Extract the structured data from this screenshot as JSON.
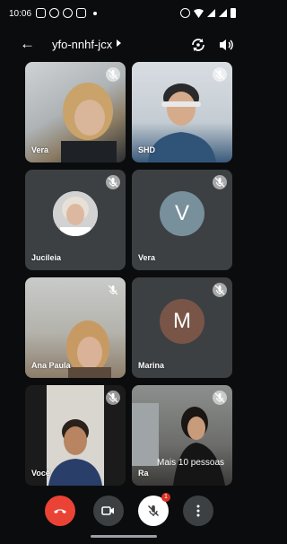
{
  "status_bar": {
    "time": "10:06"
  },
  "header": {
    "meeting_code": "yfo-nnhf-jcx"
  },
  "participants": [
    {
      "name": "Vera"
    },
    {
      "name": "SHD"
    },
    {
      "name": "Jucileia"
    },
    {
      "name": "Vera",
      "initial": "V",
      "avatar_color": "#78909c"
    },
    {
      "name": "Ana Paula"
    },
    {
      "name": "Marina",
      "initial": "M",
      "avatar_color": "#795548"
    },
    {
      "name": "Você"
    },
    {
      "name": "Ra"
    }
  ],
  "more_people": "Mais 10 pessoas",
  "controls": {
    "mic_badge": "1"
  },
  "colors": {
    "end_call": "#ea4335",
    "tile_bg": "#3c4043",
    "page_bg": "#0b0c0e"
  }
}
